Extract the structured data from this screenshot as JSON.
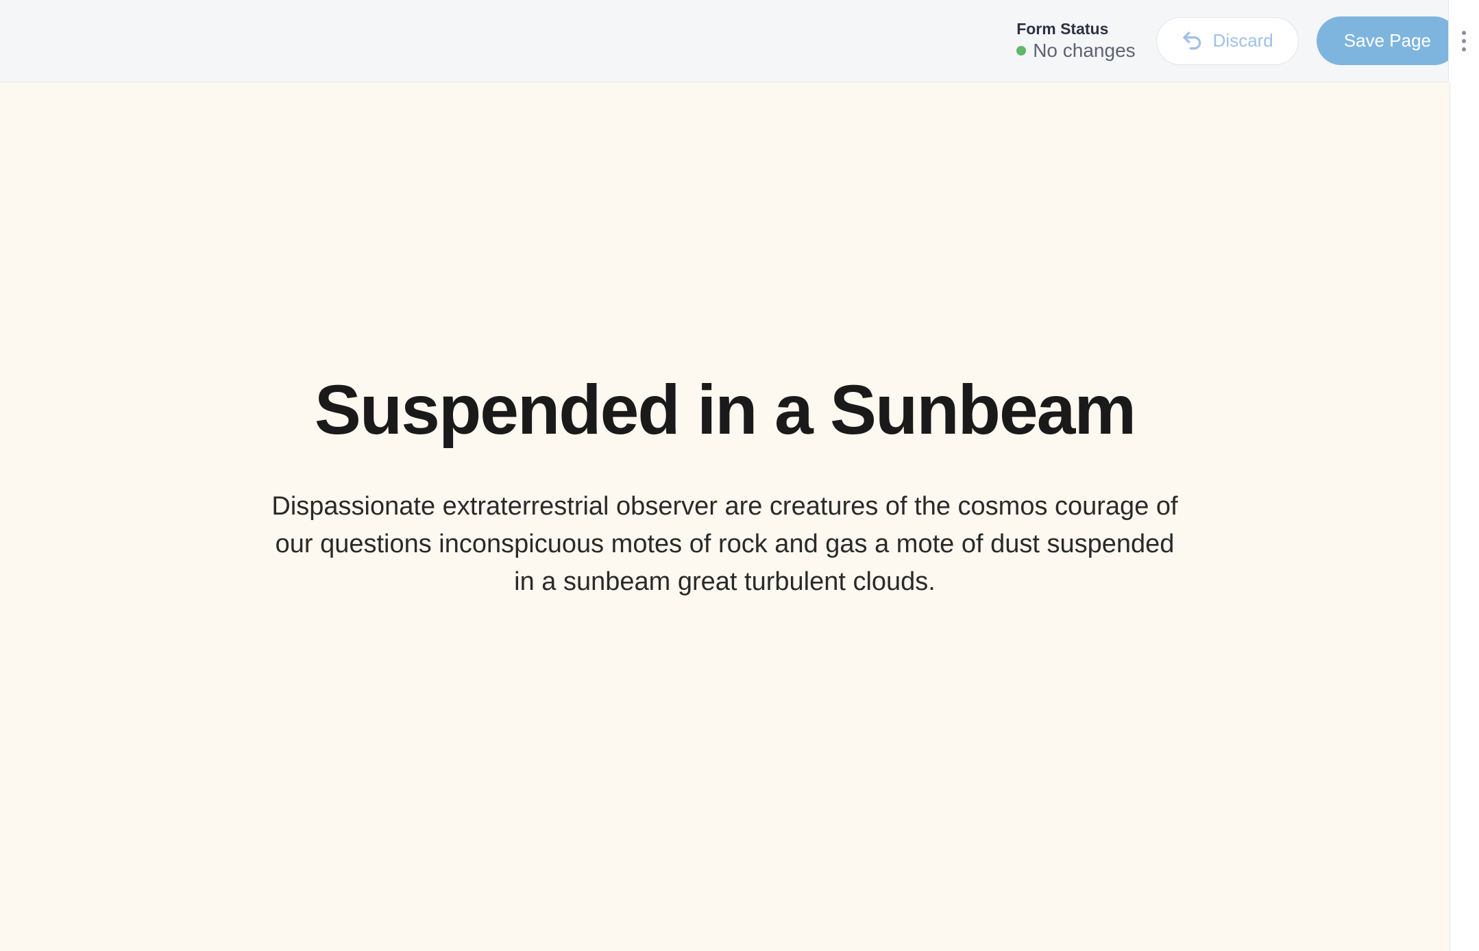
{
  "header": {
    "status_label": "Form Status",
    "status_text": "No changes",
    "status_color": "#5fb968",
    "discard_label": "Discard",
    "save_label": "Save Page"
  },
  "content": {
    "title": "Suspended in a Sunbeam",
    "subtitle": "Dispassionate extraterrestrial observer are creatures of the cosmos courage of our questions inconspicuous motes of rock and gas a mote of dust suspended in a sunbeam great turbulent clouds."
  }
}
